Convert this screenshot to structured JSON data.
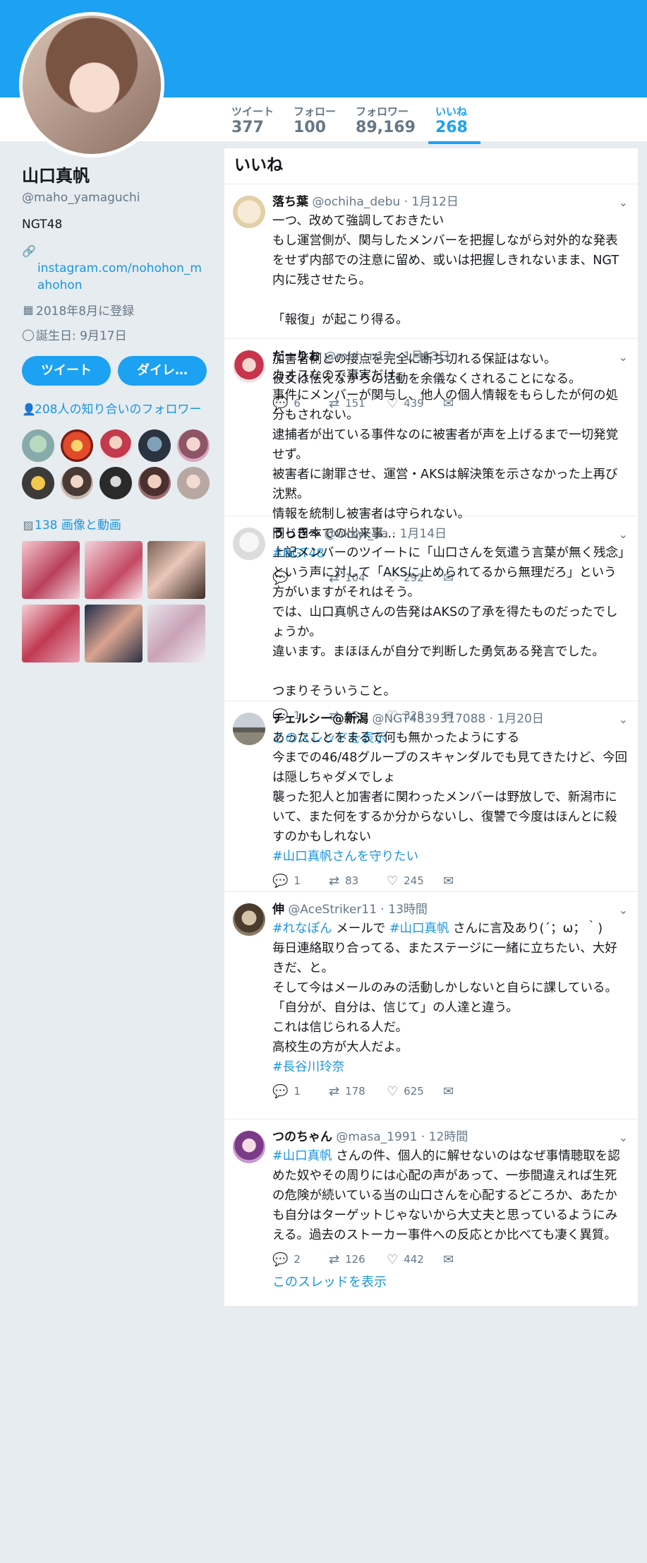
{
  "colors": {
    "accent": "#1da1f2",
    "link": "#1b95e0",
    "muted": "#657786"
  },
  "stats": [
    {
      "label": "ツイート",
      "value": "377"
    },
    {
      "label": "フォロー",
      "value": "100"
    },
    {
      "label": "フォロワー",
      "value": "89,169"
    },
    {
      "label": "いいね",
      "value": "268"
    }
  ],
  "profile": {
    "name": "山口真帆",
    "handle": "@maho_yamaguchi",
    "bio": "NGT48",
    "link": "instagram.com/nohohon_mahohon",
    "joined": "2018年8月に登録",
    "birthday": "誕生日: 9月17日",
    "tweet_button": "ツイート",
    "dm_button": "ダイレ…",
    "followers_you_know": "208人の知り合いのフォロワー",
    "media_link": "138 画像と動画"
  },
  "timeline": {
    "title": "いいね",
    "tweets": [
      {
        "name": "落ち葉",
        "handle": "@ochiha_debu",
        "time": "1月12日",
        "text": "一つ、改めて強調しておきたい\nもし運営側が、関与したメンバーを把握しながら対外的な発表をせず内部での注意に留め、或いは把握しきれないまま、NGT内に残させたら。\n\n「報復」が起こり得る。\n\n加害者側との接点を完全に断ち切れる保証はない。\n彼女は怯えながらの活動を余儀なくされることになる。",
        "replies": "6",
        "retweets": "151",
        "likes": "439"
      },
      {
        "name": "だーりお",
        "handle": "@mhh_n17",
        "time": "1月13日",
        "text": "カオスなので事実だけ。\n事件にメンバーが関与し、他人の個人情報をもらしたが何の処分もされない。\n逮捕者が出ている事件なのに被害者が声を上げるまで一切発覚せず。\n被害者に謝罪させ、運営・AKSは解決策を示さなかった上再び沈黙。\n情報を統制し被害者は守られない。\n同じ日本での出来事…",
        "hashtag": "#NGT48",
        "replies": "",
        "retweets": "104",
        "likes": "292"
      },
      {
        "name": "うっき〜",
        "handle": "@ukkyi_aa",
        "time": "1月14日",
        "text": "上記メンバーのツイートに「山口さんを気遣う言葉が無く残念」という声に対して「AKSに止められてるから無理だろ」という方がいますがそれはそう。\nでは、山口真帆さんの告発はAKSの了承を得たものだったでしょうか。\n違います。まほほんが自分で判断した勇気ある発言でした。\n\nつまりそういうこと。",
        "replies": "1",
        "retweets": "95",
        "likes": "328",
        "thread": "このスレッドを表示"
      },
      {
        "name": "チェルシー@新潟",
        "handle": "@NGT4839317088",
        "time": "1月20日",
        "text": "あったことをまるで何も無かったようにする\n今までの46/48グループのスキャンダルでも見てきたけど、今回は隠しちゃダメでしょ\n襲った犯人と加害者に関わったメンバーは野放しで、新潟市にいて、また何をするか分からないし、復讐で今度はほんとに殺すのかもしれない",
        "hashtag": "#山口真帆さんを守りたい",
        "replies": "1",
        "retweets": "83",
        "likes": "245"
      },
      {
        "name": "伸",
        "handle": "@AceStriker11",
        "time": "13時間",
        "lead_tag1": "#れなぽん",
        "lead_mid": " メールで ",
        "lead_tag2": "#山口真帆",
        "lead_end": " さんに言及あり(´；ω；｀)",
        "text": "毎日連絡取り合ってる、またステージに一緒に立ちたい、大好きだ、と。\nそして今はメールのみの活動しかしないと自らに課している。\n「自分が、自分は、信じて」の人達と違う。\nこれは信じられる人だ。\n高校生の方が大人だよ。",
        "hashtag": "#長谷川玲奈",
        "replies": "1",
        "retweets": "178",
        "likes": "625"
      },
      {
        "name": "つのちゃん",
        "handle": "@masa_1991",
        "time": "12時間",
        "lead_tag1": "#山口真帆",
        "text": " さんの件、個人的に解せないのはなぜ事情聴取を認めた奴やその周りには心配の声があって、一歩間違えれば生死の危険が続いている当の山口さんを心配するどころか、あたかも自分はターゲットじゃないから大丈夫と思っているようにみえる。過去のストーカー事件への反応とか比べても凄く異質。",
        "replies": "2",
        "retweets": "126",
        "likes": "442",
        "thread": "このスレッドを表示"
      }
    ]
  }
}
